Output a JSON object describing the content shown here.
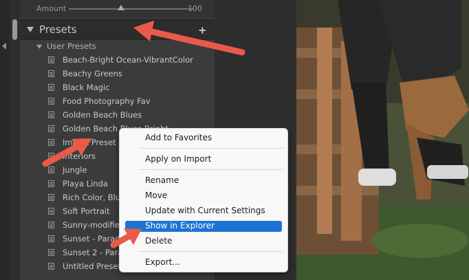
{
  "develop_panel": {
    "amount": {
      "label": "Amount",
      "value": "100"
    },
    "presets_section": {
      "title": "Presets",
      "add_icon": "plus-icon",
      "folder": {
        "name": "User Presets",
        "items": [
          "Beach-Bright Ocean-VibrantColor",
          "Beachy Greens",
          "Black Magic",
          "Food Photography Fav",
          "Golden Beach Blues",
          "Golden Beach Blues Bright",
          "Import Preset",
          "Interiors",
          "Jungle",
          "Playa Linda",
          "Rich Color, Blue",
          "Soft Portrait",
          "Sunny-modified",
          "Sunset - Paradise",
          "Sunset 2 - Paradise",
          "Untitled Preset"
        ]
      }
    }
  },
  "context_menu": {
    "items": [
      {
        "label": "Add to Favorites"
      },
      {
        "label": "Apply on Import"
      },
      {
        "label": "Rename"
      },
      {
        "label": "Move"
      },
      {
        "label": "Update with Current Settings"
      },
      {
        "label": "Show in Explorer",
        "highlighted": true
      },
      {
        "label": "Delete"
      },
      {
        "label": "Export..."
      }
    ]
  },
  "colors": {
    "panel_bg": "#3b3b3b",
    "menu_bg": "#f8f8f8",
    "menu_highlight": "#1d73d4",
    "annotation_arrow": "#ea5a4b"
  }
}
